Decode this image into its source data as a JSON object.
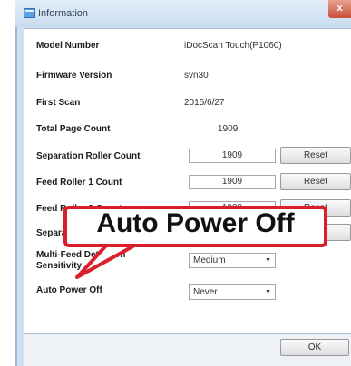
{
  "window": {
    "title": "Information",
    "close_label": "x"
  },
  "rows": {
    "model_number": {
      "label": "Model Number",
      "value": "iDocScan Touch(P1060)"
    },
    "firmware_version": {
      "label": "Firmware Version",
      "value": "svn30"
    },
    "first_scan": {
      "label": "First Scan",
      "value": "2015/6/27"
    },
    "total_page_count": {
      "label": "Total Page Count",
      "value": "1909"
    },
    "separation_roller": {
      "label": "Separation Roller Count",
      "value": "1909",
      "button": "Reset"
    },
    "feed_roller_1": {
      "label": "Feed Roller 1 Count",
      "value": "1909",
      "button": "Reset"
    },
    "feed_roller_2": {
      "label": "Feed Roller 2 Count",
      "value": "1909",
      "button": "Reset"
    },
    "separation_pad": {
      "label": "Separation Pad Count",
      "value": "1909",
      "button": "Reset"
    },
    "multi_feed": {
      "label_line1": "Multi-Feed Detection",
      "label_line2": "Sensitivity",
      "selected": "Medium"
    },
    "auto_power_off": {
      "label": "Auto Power Off",
      "selected": "Never"
    }
  },
  "ok_button": "OK",
  "callout": {
    "text": "Auto Power Off",
    "border_color": "#d9202a"
  }
}
